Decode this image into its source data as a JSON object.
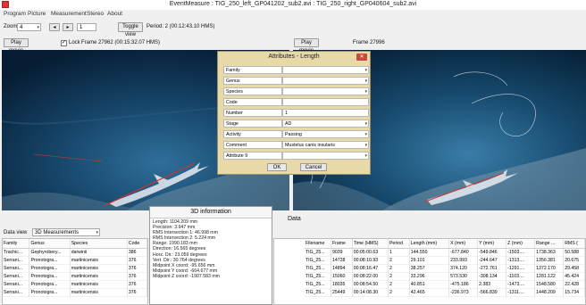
{
  "window": {
    "title": "EventMeasure : TIG_250_left_GP041202_sub2.avi : TIG_250_right_GP040604_sub2.avi"
  },
  "menu": [
    "Program",
    "Picture",
    "Measurement",
    "Stereo",
    "About"
  ],
  "toolbar": {
    "zoom_label": "Zoom",
    "zoom_value": "4",
    "step_prev": "◂",
    "step_next": "▸",
    "frame_step": "1",
    "toggle_view": "Toggle view",
    "period": "Period: 2 (00:12:43.10 HMS)"
  },
  "left_video": {
    "play": "Play movie",
    "lock_label": "Lock",
    "frame": "Frame 27962 (00:15:32.07 HMS)"
  },
  "right_video": {
    "play": "Play movie",
    "frame": "Frame 27996"
  },
  "dialog": {
    "title": "Attributes - Length",
    "close": "✕",
    "rows": [
      {
        "label": "Family",
        "value": ""
      },
      {
        "label": "Genus",
        "value": ""
      },
      {
        "label": "Species",
        "value": ""
      },
      {
        "label": "Code",
        "value": ""
      },
      {
        "label": "Number",
        "value": "1"
      },
      {
        "label": "Stage",
        "value": "AD"
      },
      {
        "label": "Activity",
        "value": "Passing"
      },
      {
        "label": "Comment",
        "value": "Mustelus canis insularis"
      },
      {
        "label": "Attribute 9",
        "value": ""
      }
    ],
    "ok": "OK",
    "cancel": "Cancel"
  },
  "data_section": {
    "title": "Data",
    "view_label": "Data view",
    "view_value": "3D Measurements"
  },
  "left_table": {
    "columns": [
      "Family",
      "Genus",
      "Species",
      "Code"
    ],
    "rows": [
      [
        "Trachic...",
        "Gephyrobery...",
        "darwinii",
        "386"
      ],
      [
        "Serrani...",
        "Pronotogra...",
        "martinicensis",
        "376"
      ],
      [
        "Serrani...",
        "Pronotogra...",
        "martinicensis",
        "376"
      ],
      [
        "Serrani...",
        "Pronotogra...",
        "martinicensis",
        "376"
      ],
      [
        "Serrani...",
        "Pronotogra...",
        "martinicensis",
        "376"
      ],
      [
        "Serrani...",
        "Pronotogra...",
        "martinicensis",
        "376"
      ]
    ]
  },
  "info": {
    "title": "3D information",
    "lines": [
      "Length: 1104.209 mm",
      "Precision: 3.947 mm",
      "RMS Intersection 1: 46.998 mm",
      "RMS Intersection 2: 5.224 mm",
      "Range: 1990.183 mm",
      "Direction: 16.565 degrees",
      "Horz. Dir.: 23.059 degrees",
      "Vert. Dir.: 30.764 degrees",
      "Midpoint X coord: -95.656 mm",
      "Midpoint Y coord: -664.677 mm",
      "Midpoint Z coord: -1907.583 mm"
    ]
  },
  "right_table": {
    "columns": [
      "Filename",
      "Frame",
      "Time (HMS)",
      "Period",
      "Length (mm)",
      "X (mm)",
      "Y (mm)",
      "Z (mm)",
      "Range ...",
      "RMS ("
    ],
    "rows": [
      [
        "TIG_25...",
        "9039",
        "00:05:00.63",
        "1",
        "144.550",
        "-677.840",
        "-549.846",
        "-1503....",
        "1738.363",
        "50.588"
      ],
      [
        "TIG_25...",
        "14728",
        "00:08:10.93",
        "2",
        "29.101",
        "233.993",
        "-244.647",
        "-1313....",
        "1356.381",
        "20.675"
      ],
      [
        "TIG_25...",
        "14894",
        "00:08:16.47",
        "2",
        "38.257",
        "374.120",
        "-272.761",
        "-1291....",
        "1372.170",
        "29.458"
      ],
      [
        "TIG_25...",
        "15060",
        "00:08:22.00",
        "2",
        "33.296",
        "573.530",
        "-308.134",
        "-1103....",
        "1281.122",
        "45.424"
      ],
      [
        "TIG_25...",
        "18035",
        "00:08:54.50",
        "2",
        "40.851",
        "-475.186",
        "2.383",
        "-1473....",
        "1548.580",
        "22.428"
      ],
      [
        "TIG_25...",
        "25449",
        "00:14:08.30",
        "2",
        "42.465",
        "-236.973",
        "-566.839",
        "-1311....",
        "1448.209",
        "15.734"
      ]
    ]
  },
  "colors": {
    "dialog_bg": "#e8d9a8",
    "water": "#0a2a4a",
    "measure_line": "#d0342c"
  }
}
